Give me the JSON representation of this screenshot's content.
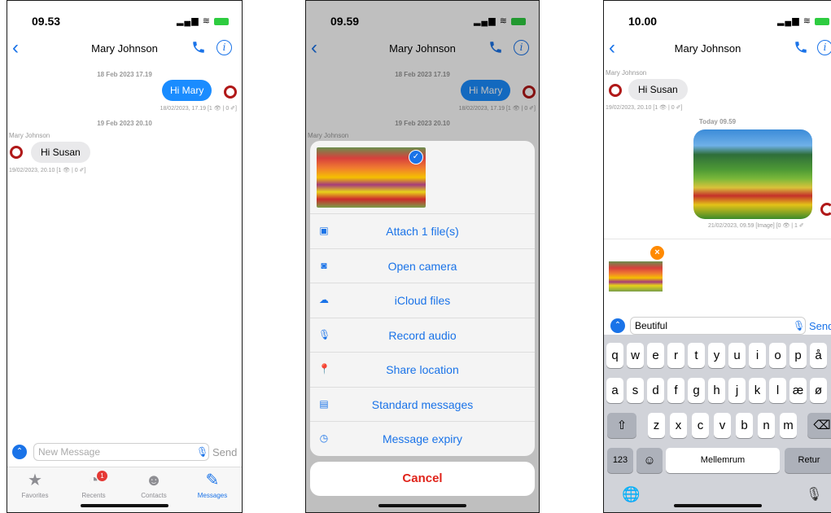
{
  "screen1": {
    "time": "09.53",
    "title": "Mary Johnson",
    "date1": "18 Feb 2023 17.19",
    "out_text": "Hi Mary",
    "out_meta": "18/02/2023, 17.19  [1 👁 | 0 ✐]",
    "date2": "19 Feb 2023 20.10",
    "sender": "Mary Johnson",
    "in_text": "Hi Susan",
    "in_meta": "19/02/2023, 20.10  [1 👁 | 0 ✐]",
    "placeholder": "New Message",
    "send": "Send",
    "tabs": [
      {
        "label": "Favorites",
        "icon": "★"
      },
      {
        "label": "Recents",
        "icon": "◔",
        "badge": "1"
      },
      {
        "label": "Contacts",
        "icon": "☻"
      },
      {
        "label": "Messages",
        "icon": "✎"
      }
    ]
  },
  "screen2": {
    "time": "09.59",
    "title": "Mary Johnson",
    "date1": "18 Feb 2023 17.19",
    "out_text": "Hi Mary",
    "out_meta": "18/02/2023, 17.19  [1 👁 | 0 ✐]",
    "date2": "19 Feb 2023 20.10",
    "sender": "Mary Johnson",
    "actions": [
      {
        "label": "Attach 1 file(s)",
        "icon": "▣"
      },
      {
        "label": "Open camera",
        "icon": "◙"
      },
      {
        "label": "iCloud files",
        "icon": "☁"
      },
      {
        "label": "Record audio",
        "icon": "🎙"
      },
      {
        "label": "Share location",
        "icon": "📍"
      },
      {
        "label": "Standard messages",
        "icon": "▤"
      },
      {
        "label": "Message expiry",
        "icon": "◷"
      }
    ],
    "cancel": "Cancel"
  },
  "screen3": {
    "time": "10.00",
    "title": "Mary Johnson",
    "sender": "Mary Johnson",
    "in_text": "Hi Susan",
    "in_meta": "19/02/2023, 20.10  [1 👁 | 0 ✐]",
    "date_today": "Today 09.59",
    "img_meta": "21/02/2023, 09.59 [Image] [0 👁 | 1 ✐",
    "input_value": "Beutiful",
    "send": "Send",
    "kb_row1": [
      "q",
      "w",
      "e",
      "r",
      "t",
      "y",
      "u",
      "i",
      "o",
      "p",
      "å"
    ],
    "kb_row2": [
      "a",
      "s",
      "d",
      "f",
      "g",
      "h",
      "j",
      "k",
      "l",
      "æ",
      "ø"
    ],
    "kb_row3": [
      "z",
      "x",
      "c",
      "v",
      "b",
      "n",
      "m"
    ],
    "kb_123": "123",
    "kb_space": "Mellemrum",
    "kb_return": "Retur"
  }
}
